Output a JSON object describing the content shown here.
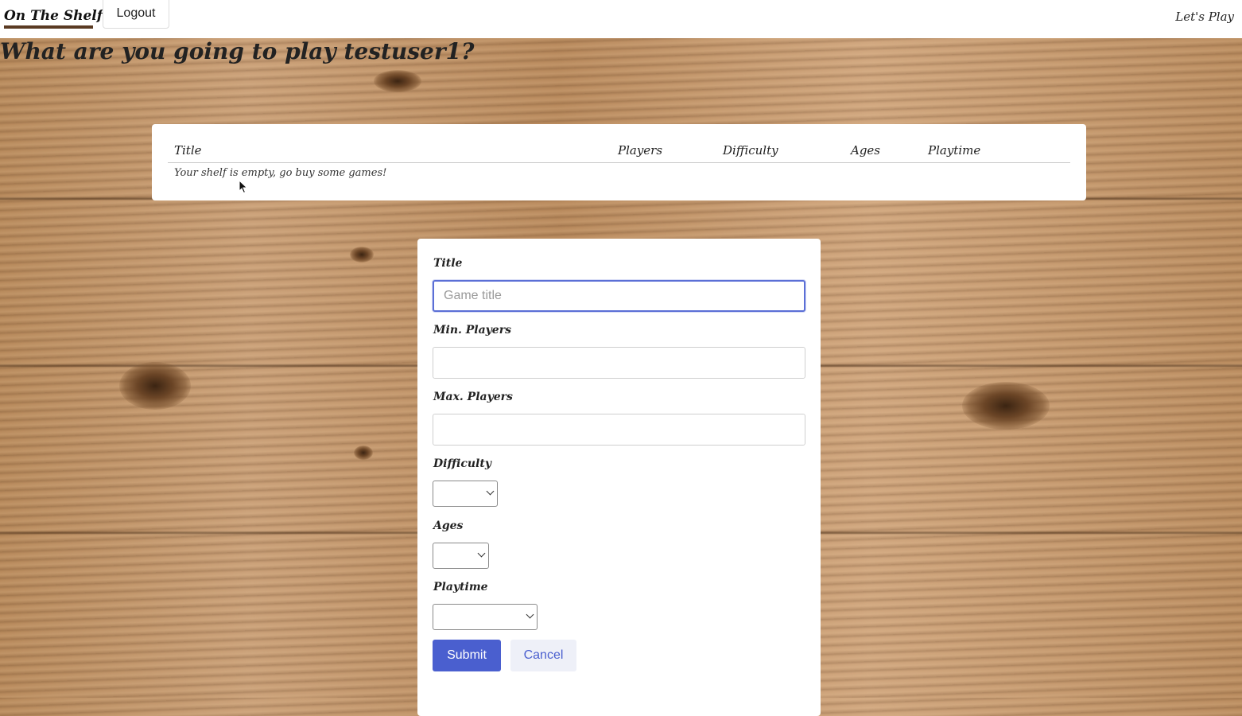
{
  "nav": {
    "logo_text": "On The Shelf",
    "logout_label": "Logout",
    "right_link": "Let's Play"
  },
  "page": {
    "heading": "What are you going to play testuser1?"
  },
  "shelf_table": {
    "columns": [
      "Title",
      "Players",
      "Difficulty",
      "Ages",
      "Playtime"
    ],
    "empty_message": "Your shelf is empty, go buy some games!"
  },
  "form": {
    "title_label": "Title",
    "title_placeholder": "Game title",
    "title_value": "",
    "min_players_label": "Min. Players",
    "min_players_value": "",
    "max_players_label": "Max. Players",
    "max_players_value": "",
    "difficulty_label": "Difficulty",
    "difficulty_value": "",
    "ages_label": "Ages",
    "ages_value": "",
    "playtime_label": "Playtime",
    "playtime_value": "",
    "submit_label": "Submit",
    "cancel_label": "Cancel"
  },
  "colors": {
    "primary": "#4a5fcf",
    "cancel_bg": "#eef0f8",
    "card_bg": "#ffffff",
    "focus_border": "#5b6fd6"
  },
  "icons": {
    "logo_mascot": "mascot-icon",
    "select_chevron": "chevron-down-icon",
    "cursor": "mouse-pointer-icon"
  }
}
